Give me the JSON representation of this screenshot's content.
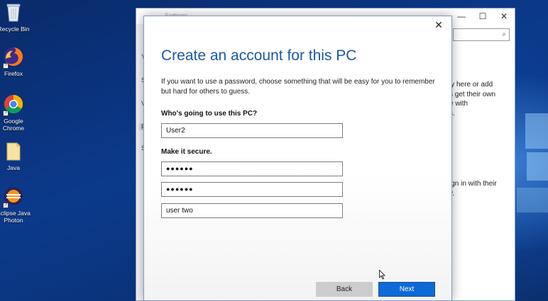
{
  "desktop": {
    "icons": [
      {
        "label": "Recycle Bin",
        "icon": "recycle-bin-icon"
      },
      {
        "label": "Firefox",
        "icon": "firefox-icon"
      },
      {
        "label_line1": "Google",
        "label_line2": "Chrome",
        "icon": "chrome-icon"
      },
      {
        "label": "Java",
        "icon": "folder-icon"
      },
      {
        "label_line1": "Eclipse Java",
        "label_line2": "Photon",
        "icon": "eclipse-icon"
      }
    ]
  },
  "settings_window": {
    "title": "Settings",
    "minimize": "—",
    "maximize": "☐",
    "close": "✕",
    "search_icon": "⌕",
    "sidebar_letters": [
      "Y",
      "S",
      "V",
      "F",
      "S"
    ],
    "bg_lines_top": [
      "ly here or add",
      "s get their own",
      "e with",
      "s."
    ],
    "bg_lines_bottom": [
      "ign in with their",
      "y."
    ]
  },
  "dialog": {
    "close": "✕",
    "title": "Create an account for this PC",
    "description": "If you want to use a password, choose something that will be easy for you to remember but hard for others to guess.",
    "who_heading": "Who's going to use this PC?",
    "username_value": "User2",
    "secure_heading": "Make it secure.",
    "password_value": "●●●●●●",
    "reenter_value": "●●●●●●",
    "hint_value": "user two",
    "back_label": "Back",
    "next_label": "Next"
  },
  "colors": {
    "accent": "#0d6ad6",
    "title": "#1a5aa6"
  }
}
